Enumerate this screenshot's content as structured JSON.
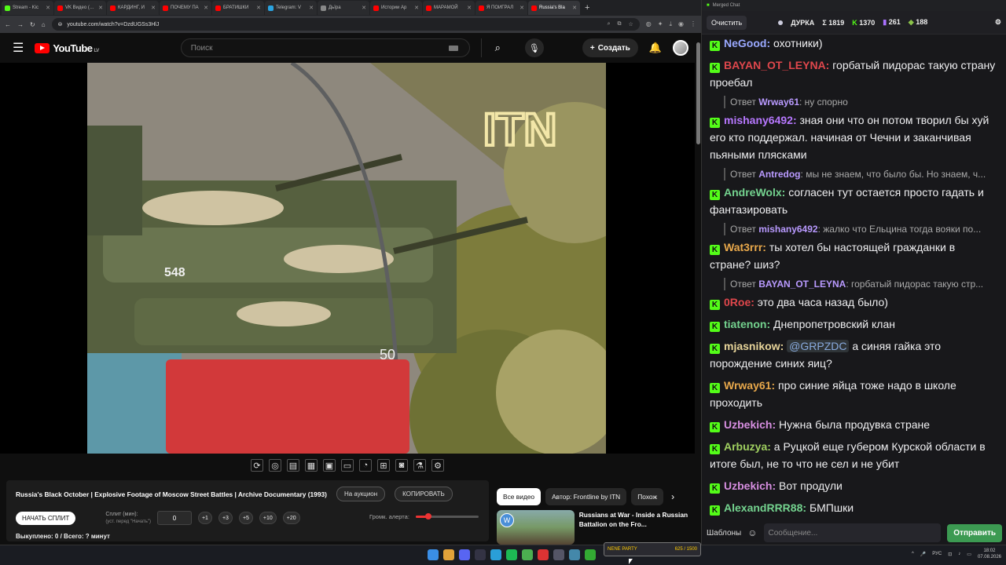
{
  "browser": {
    "tabs": [
      {
        "label": "Stream - Kic",
        "color": "#53fc18"
      },
      {
        "label": "VK Видео (…",
        "color": "#f00"
      },
      {
        "label": "КАРДИНГ, И",
        "color": "#f00"
      },
      {
        "label": "ПОЧЕМУ ПА",
        "color": "#f00"
      },
      {
        "label": "БРАТИШКИ",
        "color": "#f00"
      },
      {
        "label": "Telegram: V",
        "color": "#2aa3e0"
      },
      {
        "label": "Дьїра",
        "color": "#888"
      },
      {
        "label": "Истории Ар",
        "color": "#f00"
      },
      {
        "label": "МАРАМОЙ",
        "color": "#f00"
      },
      {
        "label": "Я ПОИГРАЛ",
        "color": "#f00"
      },
      {
        "label": "Russia's Bla",
        "color": "#f00",
        "active": true
      }
    ],
    "new_tab": "+",
    "url": "youtube.com/watch?v=DzdUGSs3HlJ"
  },
  "youtube": {
    "logo": "YouTube",
    "country": "LV",
    "search_placeholder": "Поиск",
    "create_label": "Создать"
  },
  "video": {
    "watermark": "ITN",
    "hull_number": "548",
    "road_mark": "50"
  },
  "info": {
    "title": "Russia's Black October | Explosive Footage of Moscow Street Battles | Archive Documentary (1993)",
    "auction_button": "На аукцион",
    "copy_button": "КОПИРОВАТЬ",
    "start_split": "НАЧАТЬ СПЛИТ",
    "split_label": "Сплит (мин):",
    "split_hint": "(уст. перед \"Начать\")",
    "split_value": "0",
    "increments": [
      "+1",
      "+3",
      "+5",
      "+10",
      "+20"
    ],
    "alert_volume_label": "Громк. алерта:",
    "alert_volume": 0.2,
    "stats": "Выкуплено: 0 / Всего: ? минут"
  },
  "recommendations": {
    "chips": [
      "Все видео",
      "Автор: Frontline by ITN",
      "Похож"
    ],
    "first_title": "Russians at War - Inside a Russian Battalion on the Fro..."
  },
  "chat": {
    "window_title": "Merged Chat",
    "clear_button": "Очистить",
    "channel": "ДУРКА",
    "sigma": "Σ 1819",
    "kick_count": "1370",
    "twitch_count": "261",
    "other_count": "188",
    "messages": [
      {
        "user": "NeGood",
        "color": "#9aa9ff",
        "text": "охотники)"
      },
      {
        "user": "BAYAN_OT_LEYNA",
        "color": "#e0474c",
        "text": "горбатый пидорас такую страну проебал"
      },
      {
        "reply_to": "Wrway61",
        "reply_text": "ну спорно"
      },
      {
        "user": "mishany6492",
        "color": "#b778ff",
        "text": "зная они что он потом творил бы хуй его кто поддержал. начиная от Чечни и заканчивая пьяными плясками"
      },
      {
        "reply_to": "Antredog",
        "reply_text": "мы не знаем, что было бы. Но знаем, ч..."
      },
      {
        "user": "AndreWolx",
        "color": "#74d38f",
        "text": "согласен тут остается просто гадать и фантазировать"
      },
      {
        "reply_to": "mishany6492",
        "reply_text": "жалко что Ельцина тогда вояки по..."
      },
      {
        "user": "Wat3rrr",
        "color": "#e8a84b",
        "text": "ты хотел бы настоящей гражданки в стране? шиз?"
      },
      {
        "reply_to": "BAYAN_OT_LEYNA",
        "reply_text": "горбатый пидорас такую стр..."
      },
      {
        "user": "0Roe",
        "color": "#e0474c",
        "text": "это два часа назад было)"
      },
      {
        "user": "tiatenon",
        "color": "#74d38f",
        "text": "Днепропетровский клан"
      },
      {
        "user": "mjasnikow",
        "color": "#e8d59a",
        "text": "@GRPZDC а синяя гайка это порождение синих яиц?"
      },
      {
        "user": "Wrway61",
        "color": "#e8a84b",
        "text": "про синие яйца тоже надо в школе проходить"
      },
      {
        "user": "Uzbekich",
        "color": "#d68ee0",
        "text": "Нужна была продувка стране"
      },
      {
        "user": "Arbuzya",
        "color": "#a0d060",
        "text": "а Руцкой еще губером Курской области в итоге был, не то что не сел и не убит"
      },
      {
        "user": "Uzbekich",
        "color": "#d68ee0",
        "text": "Вот продули"
      },
      {
        "user": "AlexandRRR88",
        "color": "#74d38f",
        "text": "БМПшки"
      }
    ],
    "templates_button": "Шаблоны",
    "input_placeholder": "Сообщение...",
    "send_button": "Отправить"
  },
  "taskbar": {
    "lang": "РУС",
    "time": "18:02",
    "date": "07.08.2026",
    "game_label": "NENE PARTY",
    "game_counter": "625 / 1500"
  }
}
